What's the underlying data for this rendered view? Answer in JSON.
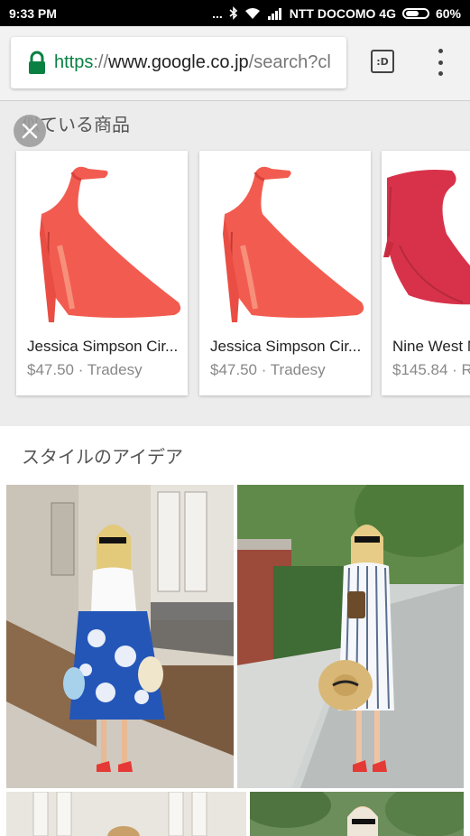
{
  "status_bar": {
    "time": "9:33 PM",
    "dots": "...",
    "carrier": "NTT DOCOMO 4G",
    "battery": "60%"
  },
  "browser": {
    "url_scheme": "https",
    "url_sep": "://",
    "url_host": "www.google.co.jp",
    "url_path": "/search?cl",
    "tabs_label": ":D"
  },
  "similar_products": {
    "title": "似ている商品",
    "items": [
      {
        "name": "Jessica Simpson Cir...",
        "meta": "$47.50 · Tradesy"
      },
      {
        "name": "Jessica Simpson Cir...",
        "meta": "$47.50 · Tradesy"
      },
      {
        "name": "Nine West N",
        "meta": "$145.84 · R"
      }
    ]
  },
  "style_ideas": {
    "title": "スタイルのアイデア"
  },
  "colors": {
    "url_scheme": "#0b8043",
    "shoe_coral": "#f25c50",
    "shoe_red": "#d8324a"
  }
}
